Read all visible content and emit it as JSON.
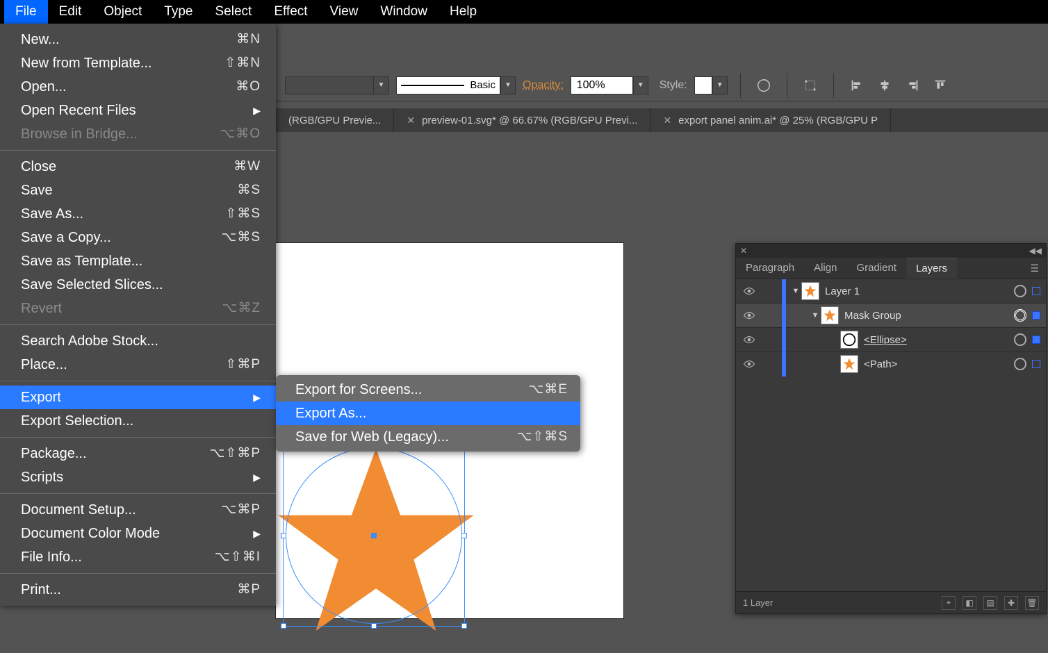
{
  "menubar": [
    "File",
    "Edit",
    "Object",
    "Type",
    "Select",
    "Effect",
    "View",
    "Window",
    "Help"
  ],
  "file_menu": {
    "groups": [
      [
        {
          "label": "New...",
          "shortcut": "⌘N"
        },
        {
          "label": "New from Template...",
          "shortcut": "⇧⌘N"
        },
        {
          "label": "Open...",
          "shortcut": "⌘O"
        },
        {
          "label": "Open Recent Files",
          "arrow": true
        },
        {
          "label": "Browse in Bridge...",
          "shortcut": "⌥⌘O",
          "disabled": true
        }
      ],
      [
        {
          "label": "Close",
          "shortcut": "⌘W"
        },
        {
          "label": "Save",
          "shortcut": "⌘S"
        },
        {
          "label": "Save As...",
          "shortcut": "⇧⌘S"
        },
        {
          "label": "Save a Copy...",
          "shortcut": "⌥⌘S"
        },
        {
          "label": "Save as Template..."
        },
        {
          "label": "Save Selected Slices..."
        },
        {
          "label": "Revert",
          "shortcut": "⌥⌘Z",
          "disabled": true
        }
      ],
      [
        {
          "label": "Search Adobe Stock..."
        },
        {
          "label": "Place...",
          "shortcut": "⇧⌘P"
        }
      ],
      [
        {
          "label": "Export",
          "arrow": true,
          "highlight": true
        },
        {
          "label": "Export Selection..."
        }
      ],
      [
        {
          "label": "Package...",
          "shortcut": "⌥⇧⌘P"
        },
        {
          "label": "Scripts",
          "arrow": true
        }
      ],
      [
        {
          "label": "Document Setup...",
          "shortcut": "⌥⌘P"
        },
        {
          "label": "Document Color Mode",
          "arrow": true
        },
        {
          "label": "File Info...",
          "shortcut": "⌥⇧⌘I"
        }
      ],
      [
        {
          "label": "Print...",
          "shortcut": "⌘P"
        }
      ]
    ]
  },
  "export_submenu": [
    {
      "label": "Export for Screens...",
      "shortcut": "⌥⌘E"
    },
    {
      "label": "Export As...",
      "highlight": true
    },
    {
      "label": "Save for Web (Legacy)...",
      "shortcut": "⌥⇧⌘S"
    }
  ],
  "controlbar": {
    "stroke_preset": "Basic",
    "opacity_label": "Opacity:",
    "opacity_value": "100%",
    "style_label": "Style:"
  },
  "tabs": [
    {
      "title": "(RGB/GPU Previe...",
      "close": false
    },
    {
      "title": "preview-01.svg* @ 66.67% (RGB/GPU Previ...",
      "close": true
    },
    {
      "title": "export panel anim.ai* @ 25% (RGB/GPU P",
      "close": true
    }
  ],
  "panel": {
    "tabs": [
      "Paragraph",
      "Align",
      "Gradient",
      "Layers"
    ],
    "active_tab": "Layers",
    "layers": [
      {
        "name": "Layer 1",
        "indent": 0,
        "disclose": true,
        "thumb": "star",
        "selchip": "outline"
      },
      {
        "name": "Mask Group",
        "indent": 1,
        "disclose": true,
        "thumb": "star",
        "selected": true,
        "target": "dbl",
        "selchip": "fill"
      },
      {
        "name": "<Ellipse>",
        "indent": 2,
        "thumb": "circle",
        "underline": true,
        "selchip": "fill"
      },
      {
        "name": "<Path>",
        "indent": 2,
        "thumb": "star",
        "selchip": "outline"
      }
    ],
    "footer_count": "1 Layer"
  }
}
